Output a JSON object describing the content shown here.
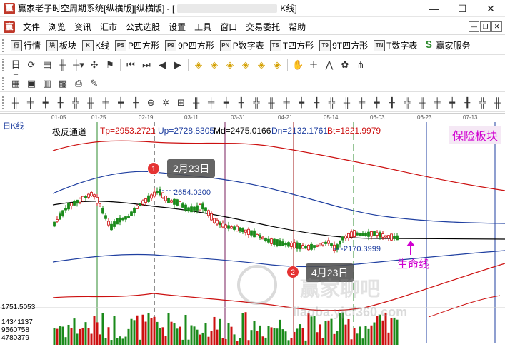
{
  "window": {
    "title_prefix": "赢家老子时空周期系统[纵横版][纵横版] - [",
    "title_suffix": "K线]",
    "minimize": "—",
    "maximize": "☐",
    "close": "✕"
  },
  "menu": {
    "items": [
      "文件",
      "浏览",
      "资讯",
      "汇市",
      "公式选股",
      "设置",
      "工具",
      "窗口",
      "交易委托",
      "帮助"
    ]
  },
  "toolbar1": {
    "buttons": [
      {
        "icon": "行",
        "label": "行情"
      },
      {
        "icon": "块",
        "label": "板块"
      },
      {
        "icon": "K",
        "label": "K线"
      },
      {
        "icon": "PS",
        "label": "P四方形"
      },
      {
        "icon": "P9",
        "label": "9P四方形"
      },
      {
        "icon": "PN",
        "label": "P数字表"
      },
      {
        "icon": "TS",
        "label": "T四方形"
      },
      {
        "icon": "T9",
        "label": "9T四方形"
      },
      {
        "icon": "TN",
        "label": "T数字表"
      },
      {
        "icon": "$",
        "label": "赢家服务"
      }
    ]
  },
  "chart": {
    "period_label": "日K线",
    "indicator_name": "极反通道",
    "tp": "Tp=2953.2721",
    "up": "Up=2728.8305",
    "md": "Md=2475.0166",
    "dn": "Dn=2132.1761",
    "bt": "Bt=1821.9979",
    "sector": "保险板块",
    "callout1_num": "1",
    "callout1_text": "2月23日",
    "callout2_num": "2",
    "callout2_text": "4月23日",
    "price_high": "2654.0200",
    "price_low": "2170.3999",
    "lifeline": "生命线",
    "axis_low": "1751.5053",
    "volume_values": [
      "14341137",
      "9560758",
      "4780379"
    ],
    "dates": [
      "01-05",
      "01-25",
      "02-19",
      "03-11",
      "03-31",
      "04-21",
      "05-14",
      "06-03",
      "06-23",
      "07-13"
    ],
    "watermark": "赢家聊吧",
    "watermark_url": "liaoba.yjcf360.com"
  }
}
